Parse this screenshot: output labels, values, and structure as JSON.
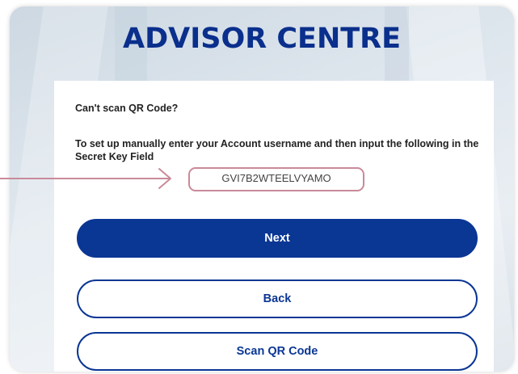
{
  "header": {
    "title": "ADVISOR CENTRE"
  },
  "setup": {
    "heading": "Can't scan QR Code?",
    "instructions": "To set up manually enter your Account username and then input the following in the Secret Key Field",
    "secret_key": "GVI7B2WTEELVYAMO"
  },
  "buttons": {
    "next_label": "Next",
    "back_label": "Back",
    "scan_label": "Scan QR Code"
  },
  "colors": {
    "brand_blue": "#0a3694",
    "title_blue": "#0a2f8c",
    "highlight": "#c98a9a"
  },
  "icons": {
    "callout": "arrow-right-icon"
  }
}
